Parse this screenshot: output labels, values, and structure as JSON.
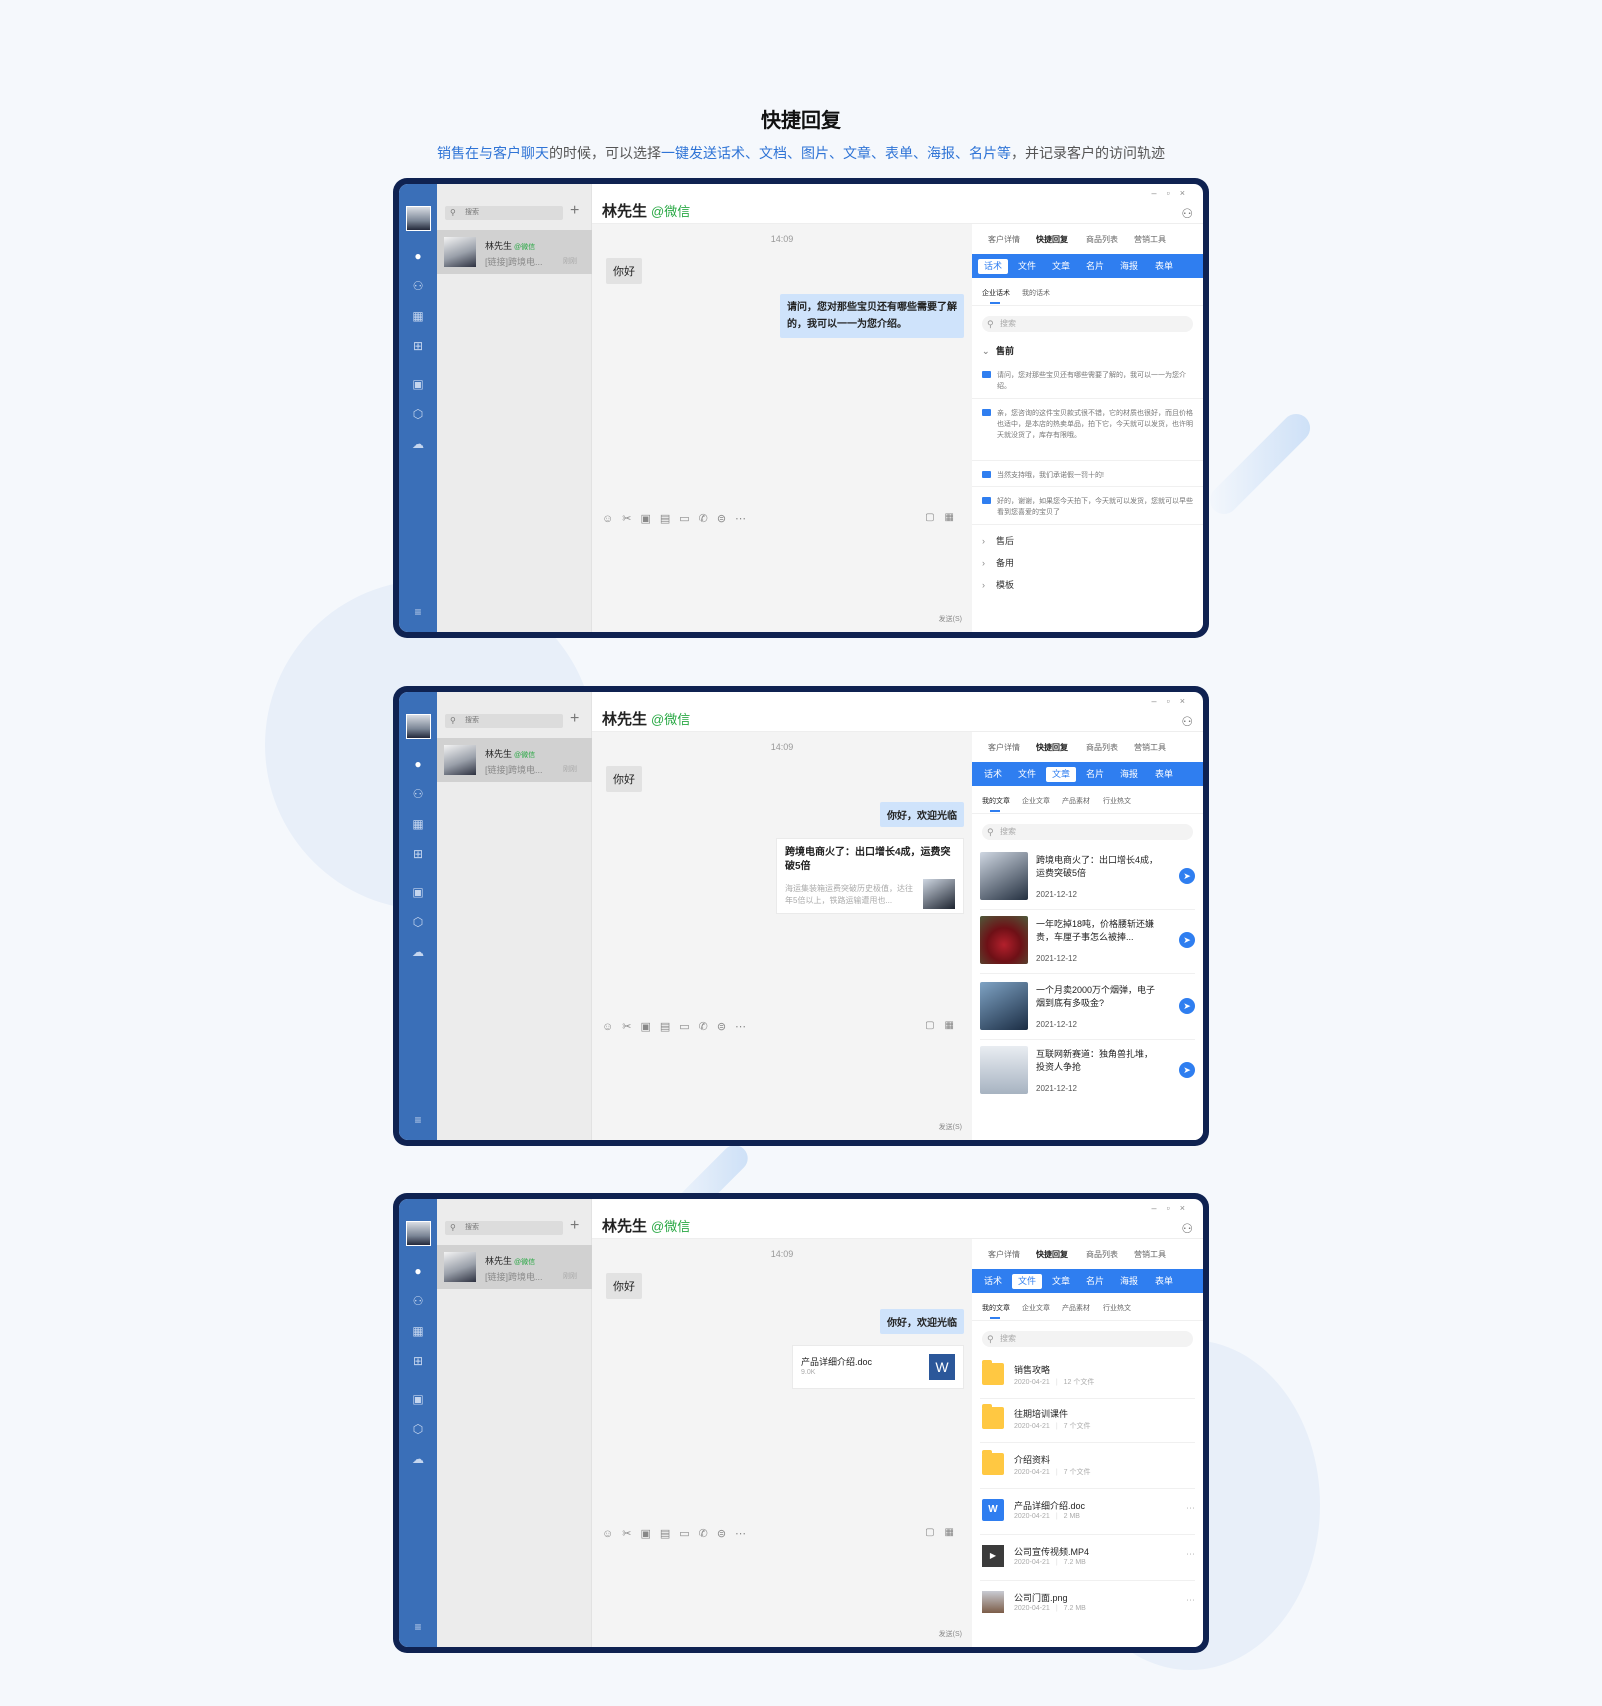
{
  "page": {
    "title": "快捷回复",
    "subtitle": [
      {
        "text": "销售在与客户聊天",
        "hl": true
      },
      {
        "text": "的时候，可以选择",
        "hl": false
      },
      {
        "text": "一键发送话术、文档、图片、文章、表单、海报、名片等",
        "hl": true
      },
      {
        "text": "，并记录客户的访问轨迹",
        "hl": false
      }
    ]
  },
  "common": {
    "search_placeholder": "搜索",
    "conversation": {
      "name": "林先生",
      "badge": "@微信",
      "preview": "[链接]跨境电...",
      "time": "刚刚"
    },
    "chat_header": {
      "name": "林先生",
      "via": "@微信"
    },
    "chat_time": "14:09",
    "greeting": "你好",
    "send_label": "发送(S)",
    "panel_tabs": [
      "客户详情",
      "快捷回复",
      "商品列表",
      "营销工具"
    ],
    "active_panel_tab": 1,
    "quick_tabs": [
      "话术",
      "文件",
      "文章",
      "名片",
      "海报",
      "表单"
    ],
    "panel_search": "搜索",
    "colors": {
      "accent": "#2f7ef0",
      "rail": "#3a6fb8",
      "frame": "#0f2251",
      "wechat": "#29a844"
    }
  },
  "screen1": {
    "active_quick_tab": 0,
    "subtabs": [
      "企业话术",
      "我的话术"
    ],
    "reply": "请问，您对那些宝贝还有哪些需要了解的，我可以一一为您介绍。",
    "group_open": "售前",
    "phrases": [
      "请问，您对那些宝贝还有哪些需要了解的，我可以一一为您介绍。",
      "亲，您咨询的这件宝贝款式很不错，它的材质也很好，而且价格也适中，是本店的热卖单品，拍下它，今天就可以发货，也许明天就没货了，库存有限哦。",
      "当然支持哦，我们承诺假一罚十的!",
      "好的，谢谢，如果您今天拍下，今天就可以发货，您就可以早些看到您喜爱的宝贝了"
    ],
    "groups_closed": [
      "售后",
      "备用",
      "模板"
    ]
  },
  "screen2": {
    "active_quick_tab": 2,
    "subtabs": [
      "我的文章",
      "企业文章",
      "产品素材",
      "行业热文"
    ],
    "reply": "你好，欢迎光临",
    "card": {
      "title": "跨境电商火了：出口增长4成，运费突破5倍",
      "desc": "海运集装箱运费突破历史极值，达往年5倍以上，铁路运输遭甩也..."
    },
    "articles": [
      {
        "title": "跨境电商火了：出口增长4成，运费突破5倍",
        "date": "2021-12-12"
      },
      {
        "title": "一年吃掉18吨，价格腰斩还嫌贵，车厘子事怎么被捧...",
        "date": "2021-12-12"
      },
      {
        "title": "一个月卖2000万个烟弹，电子烟到底有多吸金?",
        "date": "2021-12-12"
      },
      {
        "title": "互联网新赛道：独角兽扎堆，投资人争抢",
        "date": "2021-12-12"
      }
    ]
  },
  "screen3": {
    "active_quick_tab": 1,
    "subtabs": [
      "我的文章",
      "企业文章",
      "产品素材",
      "行业热文"
    ],
    "reply": "你好，欢迎光临",
    "file_card": {
      "name": "产品详细介绍.doc",
      "size": "9.0K",
      "icon": "W"
    },
    "files": [
      {
        "type": "folder",
        "name": "销售攻略",
        "date": "2020-04-21",
        "meta": "12 个文件"
      },
      {
        "type": "folder",
        "name": "往期培训课件",
        "date": "2020-04-21",
        "meta": "7 个文件"
      },
      {
        "type": "folder",
        "name": "介绍资料",
        "date": "2020-04-21",
        "meta": "7 个文件"
      },
      {
        "type": "word",
        "name": "产品详细介绍.doc",
        "date": "2020-04-21",
        "meta": "2 MB",
        "icon": "W"
      },
      {
        "type": "video",
        "name": "公司宣传视频.MP4",
        "date": "2020-04-21",
        "meta": "7.2 MB",
        "icon": "▶"
      },
      {
        "type": "img",
        "name": "公司门面.png",
        "date": "2020-04-21",
        "meta": "7.2 MB"
      }
    ]
  }
}
